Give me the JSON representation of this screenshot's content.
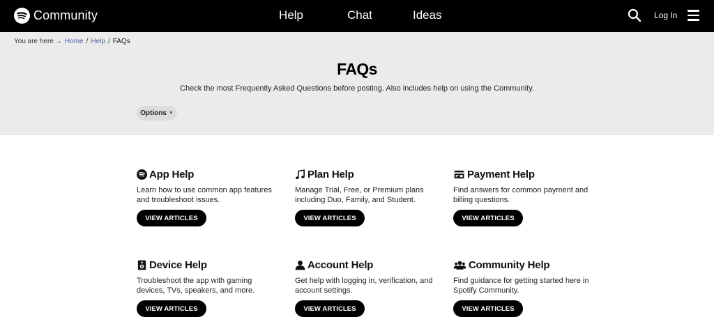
{
  "header": {
    "brand": "Community",
    "nav": [
      "Help",
      "Chat",
      "Ideas"
    ],
    "login": "Log In"
  },
  "breadcrumb": {
    "prefix": "You are here",
    "items": [
      "Home",
      "Help"
    ],
    "current": "FAQs"
  },
  "page": {
    "title": "FAQs",
    "description": "Check the most Frequently Asked Questions before posting. Also includes help on using the Community.",
    "options_label": "Options"
  },
  "cards": [
    {
      "icon": "spotify-icon",
      "title": "App Help",
      "description": "Learn how to use common app features and troubleshoot issues.",
      "button": "VIEW ARTICLES"
    },
    {
      "icon": "music-note-icon",
      "title": "Plan Help",
      "description": "Manage Trial, Free, or Premium plans including Duo, Family, and Student.",
      "button": "VIEW ARTICLES"
    },
    {
      "icon": "payment-card-icon",
      "title": "Payment Help",
      "description": "Find answers for common payment and billing questions.",
      "button": "VIEW ARTICLES"
    },
    {
      "icon": "speaker-icon",
      "title": "Device Help",
      "description": "Troubleshoot the app with gaming devices, TVs, speakers, and more.",
      "button": "VIEW ARTICLES"
    },
    {
      "icon": "user-icon",
      "title": "Account Help",
      "description": "Get help with logging in, verification, and account settings.",
      "button": "VIEW ARTICLES"
    },
    {
      "icon": "users-icon",
      "title": "Community Help",
      "description": "Find guidance for getting started here in Spotify Community.",
      "button": "VIEW ARTICLES"
    }
  ],
  "colors": {
    "topbar": "#000000",
    "hero_bg": "#ebebeb",
    "link": "#4a5ea8",
    "button_bg": "#000000"
  }
}
